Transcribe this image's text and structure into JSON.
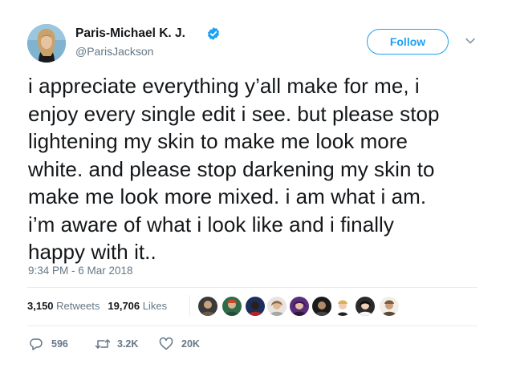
{
  "author": {
    "display_name": "Paris-Michael K. J.",
    "handle": "@ParisJackson",
    "verified": true,
    "avatar_icon": "profile-photo"
  },
  "header": {
    "follow_label": "Follow",
    "menu_icon": "chevron-down-icon"
  },
  "tweet": {
    "lines": [
      "i appreciate everything y’all make for me, i",
      "enjoy every single edit i see. but please stop",
      "lightening my skin to make me look more",
      "white. and please stop darkening my skin to",
      "make me look more mixed. i am what i am.",
      "i’m aware of what i look like and i finally",
      "happy with it.."
    ],
    "timestamp": "9:34 PM - 6 Mar 2018"
  },
  "stats": {
    "retweets_count": "3,150",
    "retweets_label": "Retweets",
    "likes_count": "19,706",
    "likes_label": "Likes"
  },
  "likers": {
    "count_shown": 9
  },
  "actions": {
    "reply_count": "596",
    "retweet_count": "3.2K",
    "like_count": "20K"
  },
  "colors": {
    "brand_blue": "#1da1f2",
    "text_primary": "#14171a",
    "text_secondary": "#657786",
    "divider": "#e6ecf0"
  }
}
